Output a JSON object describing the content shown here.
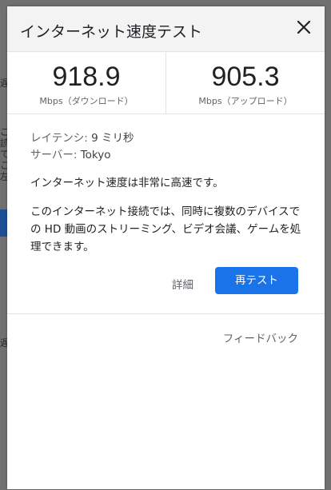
{
  "background": {
    "fragments": [
      "遅",
      "ご",
      "読",
      "て",
      "こ",
      "左",
      "遅"
    ]
  },
  "dialog": {
    "title": "インターネット速度テスト",
    "close_icon": "close-icon"
  },
  "speeds": {
    "download": {
      "value": "918.9",
      "unit": "Mbps（ダウンロード）"
    },
    "upload": {
      "value": "905.3",
      "unit": "Mbps（アップロード）"
    }
  },
  "info": {
    "latency_label": "レイテンシ:",
    "latency_value": "9 ミリ秒",
    "server_label": "サーバー:",
    "server_value": "Tokyo",
    "summary": "インターネット速度は非常に高速です。",
    "description": "このインターネット接続では、同時に複数のデバイスでの HD 動画のストリーミング、ビデオ会議、ゲームを処理できます。"
  },
  "actions": {
    "details_label": "詳細",
    "retest_label": "再テスト"
  },
  "footer": {
    "feedback_label": "フィードバック"
  },
  "colors": {
    "accent": "#1a73e8",
    "header_bg": "#f3f3f3",
    "backdrop": "#707070"
  }
}
